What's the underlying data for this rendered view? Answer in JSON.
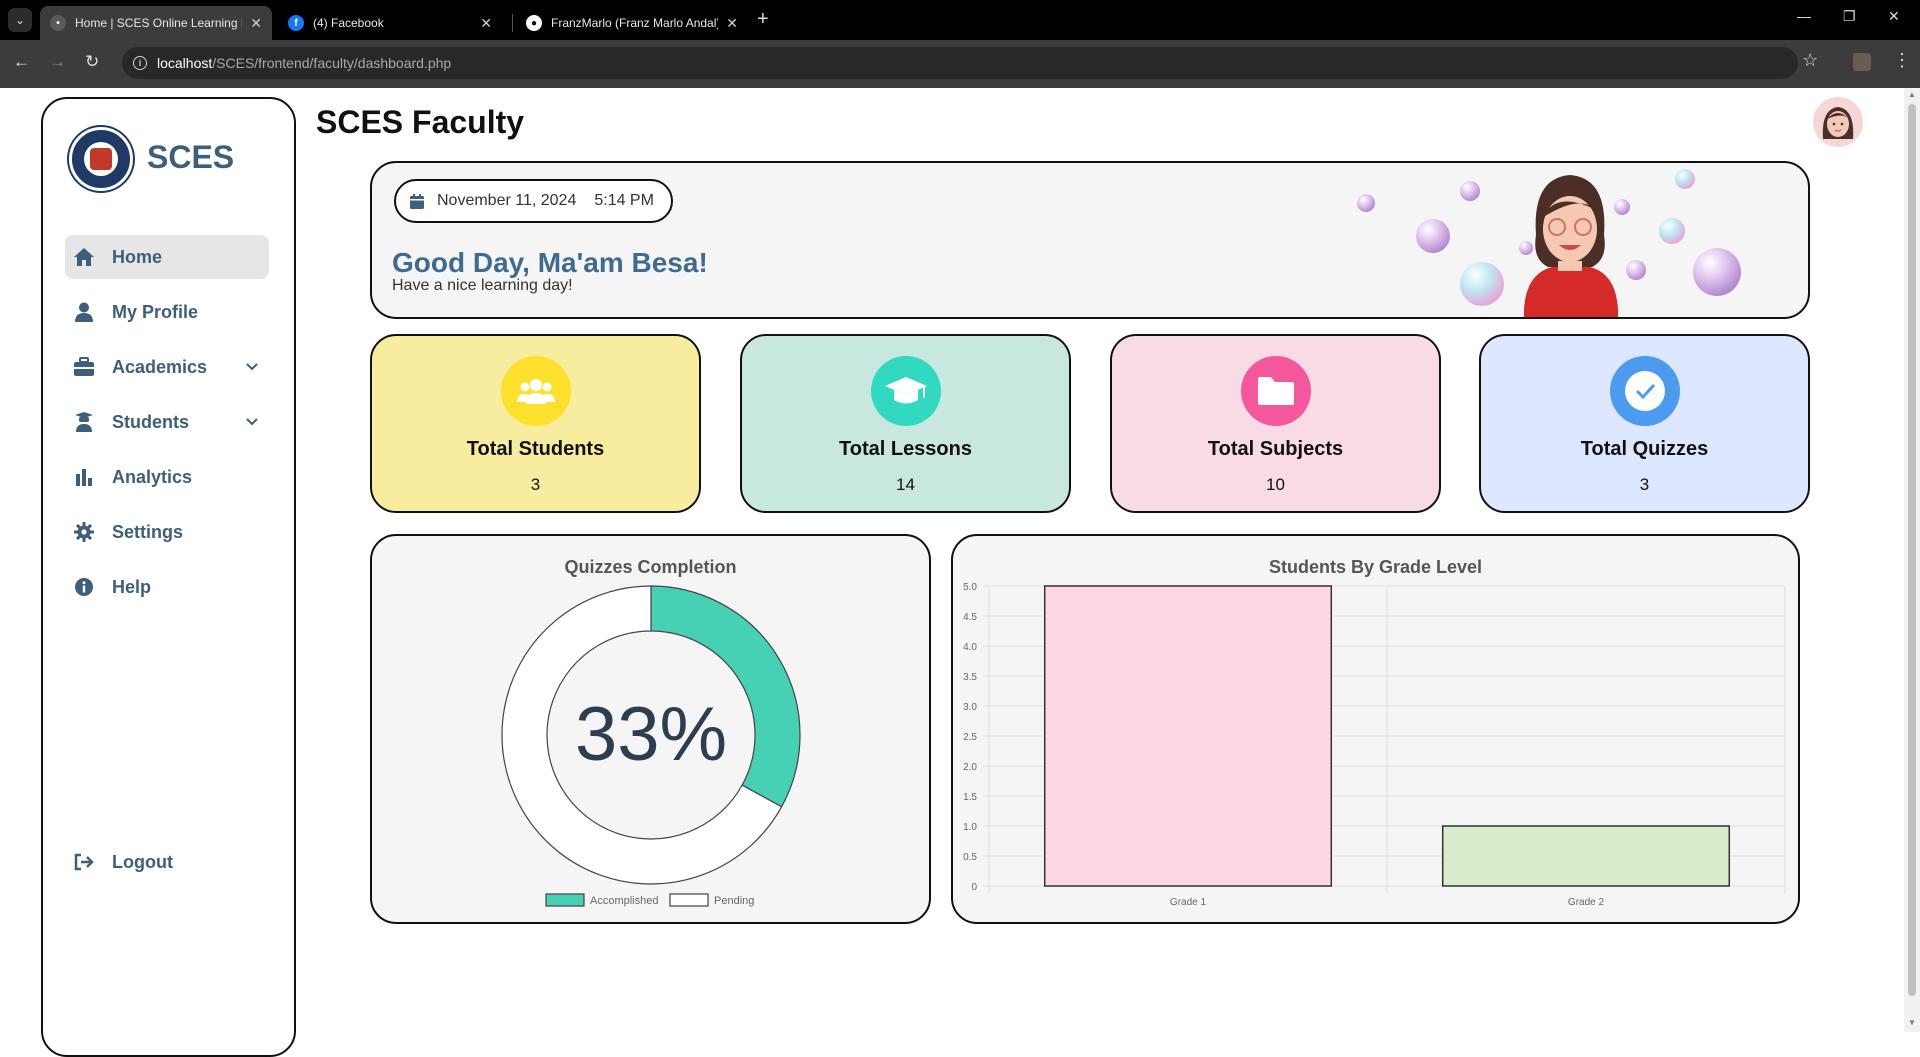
{
  "browser": {
    "tabs": [
      {
        "title": "Home | SCES Online Learning P",
        "active": true
      },
      {
        "title": "(4) Facebook",
        "active": false
      },
      {
        "title": "FranzMarlo (Franz Marlo Andal)",
        "active": false
      }
    ],
    "url_host": "localhost",
    "url_path": "/SCES/frontend/faculty/dashboard.php"
  },
  "sidebar": {
    "brand": "SCES",
    "items": [
      {
        "label": "Home",
        "icon": "home-icon",
        "active": true
      },
      {
        "label": "My Profile",
        "icon": "user-icon"
      },
      {
        "label": "Academics",
        "icon": "briefcase-icon",
        "expandable": true
      },
      {
        "label": "Students",
        "icon": "student-icon",
        "expandable": true
      },
      {
        "label": "Analytics",
        "icon": "bar-chart-icon"
      },
      {
        "label": "Settings",
        "icon": "gear-icon"
      },
      {
        "label": "Help",
        "icon": "info-icon"
      }
    ],
    "logout": "Logout"
  },
  "header": {
    "title": "SCES Faculty"
  },
  "banner": {
    "date": "November 11, 2024",
    "time": "5:14 PM",
    "greeting": "Good Day, Ma'am Besa!",
    "subtitle": "Have a nice learning day!"
  },
  "stats": [
    {
      "label": "Total Students",
      "value": "3",
      "icon": "users-icon",
      "color": "#f8ec9f",
      "icon_color": "#fde02b"
    },
    {
      "label": "Total Lessons",
      "value": "14",
      "icon": "graduation-cap-icon",
      "color": "#c8e8df",
      "icon_color": "#30d9bf"
    },
    {
      "label": "Total Subjects",
      "value": "10",
      "icon": "folder-icon",
      "color": "#f9dbe5",
      "icon_color": "#f4579b"
    },
    {
      "label": "Total Quizzes",
      "value": "3",
      "icon": "check-circle-icon",
      "color": "#dde7ff",
      "icon_color": "#4c9bef"
    }
  ],
  "quizzes_panel": {
    "title": "Quizzes Completion",
    "center_label": "33%",
    "legend": [
      "Accomplished",
      "Pending"
    ]
  },
  "grade_panel": {
    "title": "Students By Grade Level"
  },
  "chart_data": [
    {
      "type": "pie",
      "title": "Quizzes Completion",
      "labels": [
        "Accomplished",
        "Pending"
      ],
      "values": [
        33,
        67
      ],
      "colors": [
        "#47d1b4",
        "#ffffff"
      ],
      "legend": "bottom"
    },
    {
      "type": "bar",
      "title": "Students By Grade Level",
      "categories": [
        "Grade 1",
        "Grade 2"
      ],
      "values": [
        5,
        1
      ],
      "colors": [
        "#ffd6e5",
        "#d8eccb"
      ],
      "ylim": [
        0,
        5
      ],
      "yticks": [
        "0",
        "0.5",
        "1.0",
        "1.5",
        "2.0",
        "2.5",
        "3.0",
        "3.5",
        "4.0",
        "4.5",
        "5.0"
      ],
      "grid": true
    }
  ]
}
